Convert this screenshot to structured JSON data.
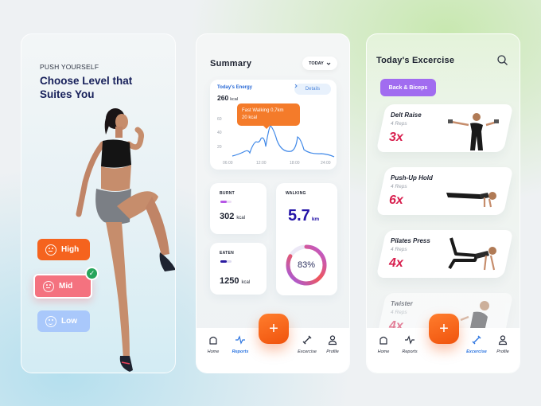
{
  "screen1": {
    "eyebrow": "PUSH YOURSELF",
    "title": "Choose Level that Suites You",
    "levels": [
      {
        "label": "High",
        "color": "#f5631e",
        "selected": false
      },
      {
        "label": "Mid",
        "color": "#f4727f",
        "selected": true
      },
      {
        "label": "Low",
        "color": "#a9c8fb",
        "selected": false
      }
    ],
    "check_glyph": "✓"
  },
  "screen2": {
    "title": "Summary",
    "period": "TODAY",
    "period_icon": "chevron-down-icon",
    "energy": {
      "label": "Today's Energy",
      "value": "260",
      "unit": "kcal",
      "details_label": "Details",
      "tooltip_line1": "Fast Walking 0,7km",
      "tooltip_line2": "20 kcal",
      "y_ticks": [
        "60",
        "40",
        "20"
      ],
      "x_ticks": [
        "06:00",
        "12:00",
        "18:00",
        "24:00"
      ]
    },
    "burnt": {
      "label": "BURNT",
      "value": "302",
      "unit": "kcal",
      "progress": 0.6,
      "color": "#b657e6"
    },
    "eaten": {
      "label": "EATEN",
      "value": "1250",
      "unit": "kcal",
      "progress": 0.6,
      "color": "#2a1aa0"
    },
    "walking": {
      "label": "WALKING",
      "value": "5.7",
      "unit": "km",
      "percent_label": "83%",
      "percent": 0.83
    },
    "nav": [
      {
        "label": "Home",
        "icon": "home-icon",
        "active": false
      },
      {
        "label": "Reports",
        "icon": "activity-icon",
        "active": true
      },
      {
        "label": "Excercise",
        "icon": "dumbbell-icon",
        "active": false
      },
      {
        "label": "Profile",
        "icon": "user-icon",
        "active": false
      }
    ],
    "fab_label": "+"
  },
  "screen3": {
    "title": "Today's Excercise",
    "category": "Back & Biceps",
    "exercises": [
      {
        "name": "Delt Raise",
        "reps": "4 Reps",
        "sets": "3x"
      },
      {
        "name": "Push-Up Hold",
        "reps": "4 Reps",
        "sets": "6x"
      },
      {
        "name": "Pilates Press",
        "reps": "4 Reps",
        "sets": "4x"
      },
      {
        "name": "Twister",
        "reps": "4 Reps",
        "sets": "4x"
      }
    ],
    "nav": [
      {
        "label": "Home",
        "icon": "home-icon",
        "active": false
      },
      {
        "label": "Reports",
        "icon": "activity-icon",
        "active": false
      },
      {
        "label": "Excercise",
        "icon": "dumbbell-icon",
        "active": true
      },
      {
        "label": "Profile",
        "icon": "user-icon",
        "active": false
      }
    ],
    "fab_label": "+"
  }
}
